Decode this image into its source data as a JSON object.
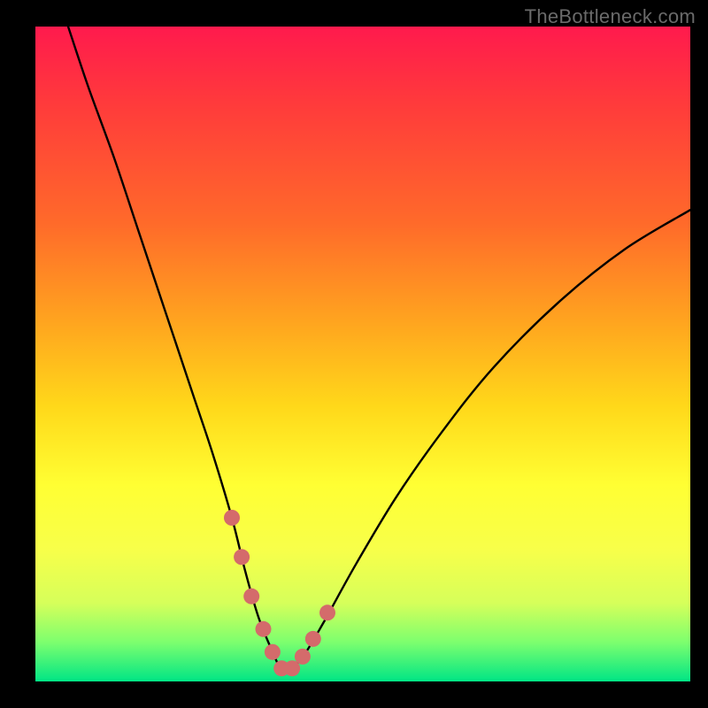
{
  "attribution": "TheBottleneck.com",
  "colors": {
    "page_bg": "#000000",
    "gradient_top": "#ff1a4d",
    "gradient_bottom": "#00e585",
    "curve": "#000000",
    "marker": "#d46b6b"
  },
  "chart_data": {
    "type": "line",
    "title": "",
    "xlabel": "",
    "ylabel": "",
    "xlim": [
      0,
      100
    ],
    "ylim": [
      0,
      100
    ],
    "grid": false,
    "legend": false,
    "series": [
      {
        "name": "bottleneck-curve",
        "x": [
          5,
          8,
          12,
          16,
          20,
          24,
          27,
          30,
          32,
          34,
          36,
          37.5,
          39,
          41,
          44,
          49,
          55,
          62,
          70,
          80,
          90,
          100
        ],
        "y": [
          100,
          91,
          80,
          68,
          56,
          44,
          35,
          25,
          17,
          10,
          5,
          2,
          2,
          4,
          9,
          18,
          28,
          38,
          48,
          58,
          66,
          72
        ]
      }
    ],
    "markers": {
      "name": "highlighted-points",
      "x": [
        30,
        31.5,
        33,
        34.8,
        36.2,
        37.6,
        39.2,
        40.8,
        42.4,
        44.6
      ],
      "y": [
        25,
        19,
        13,
        8,
        4.5,
        2,
        2,
        3.8,
        6.5,
        10.5
      ]
    }
  }
}
